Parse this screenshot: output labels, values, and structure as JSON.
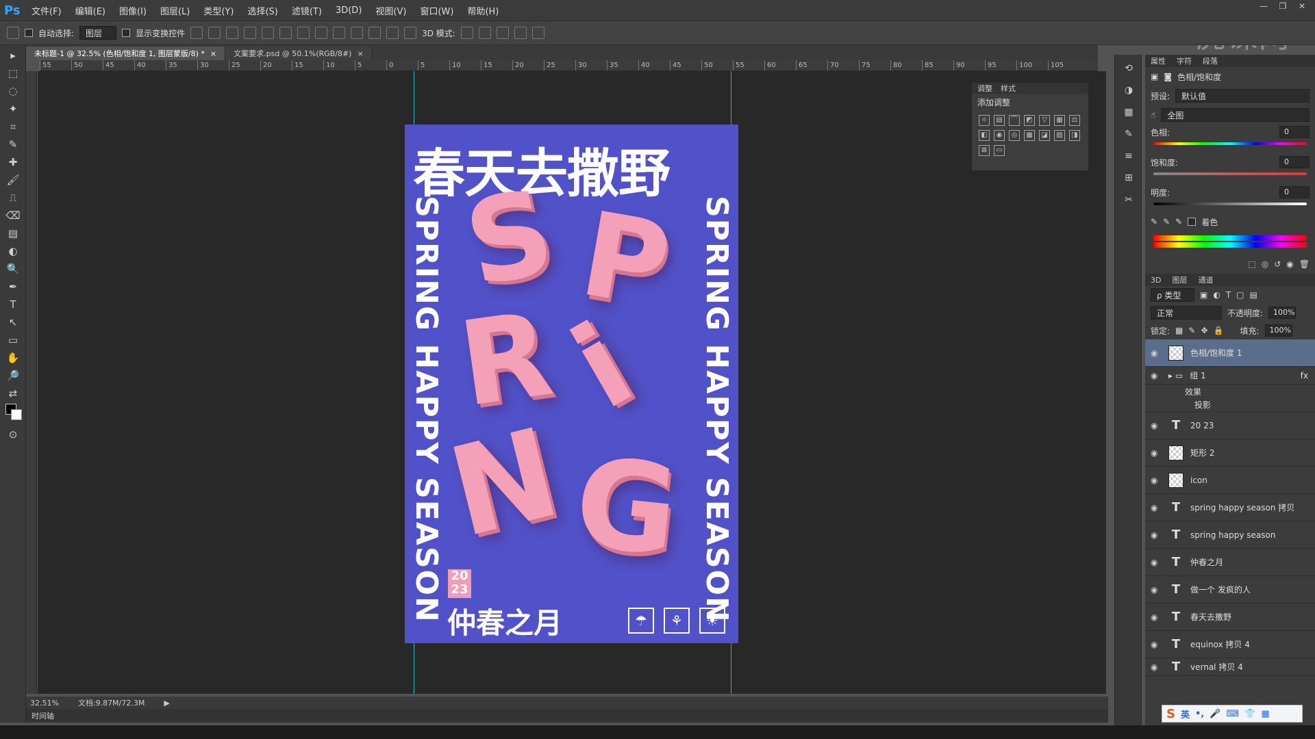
{
  "app": {
    "logo": "Ps",
    "menu": [
      "文件(F)",
      "编辑(E)",
      "图像(I)",
      "图层(L)",
      "类型(Y)",
      "选择(S)",
      "滤镜(T)",
      "3D(D)",
      "视图(V)",
      "窗口(W)",
      "帮助(H)"
    ],
    "watermark": "虎课网",
    "window_controls": [
      "—",
      "❐",
      "✕"
    ]
  },
  "options_bar": {
    "auto_select_label": "自动选择:",
    "auto_select_value": "图层",
    "show_transform_label": "显示变换控件",
    "mode_3d_label": "3D 模式:"
  },
  "tools": [
    "▸",
    "⬚",
    "◌",
    "✦",
    "⌗",
    "✎",
    "✚",
    "🖌",
    "⎍",
    "⌫",
    "▤",
    "◐",
    "🔍",
    "✒",
    "T",
    "↖",
    "▭",
    "✋",
    "🔎",
    "⇄",
    "⊙"
  ],
  "doc_tabs": [
    {
      "label": "未标题-1 @ 32.5% (色相/饱和度 1, 图层蒙版/8) *",
      "active": true
    },
    {
      "label": "文案要求.psd @ 50.1%(RGB/8#)",
      "active": false
    }
  ],
  "ruler_ticks": [
    "55",
    "50",
    "45",
    "40",
    "35",
    "30",
    "25",
    "20",
    "15",
    "10",
    "5",
    "0",
    "5",
    "10",
    "15",
    "20",
    "25",
    "30",
    "35",
    "40",
    "45",
    "50",
    "55",
    "60",
    "65",
    "70",
    "75",
    "80",
    "85",
    "90",
    "95",
    "100",
    "105"
  ],
  "poster": {
    "title": "春天去撒野",
    "bubble_letters": [
      "S",
      "P",
      "R",
      "i",
      "N",
      "G"
    ],
    "side_left": "SPRING HAPPY SEASON",
    "side_right": "SPRING HAPPY SEASON",
    "year_top": "20",
    "year_bottom": "23",
    "bottom_title": "仲春之月",
    "icons": [
      "rain-cloud-icon",
      "sprout-icon",
      "sun-cloud-icon"
    ],
    "bg_color": "#5152c9",
    "accent_color": "#f29cb6"
  },
  "adjust_panel": {
    "tabs": [
      "调整",
      "样式"
    ],
    "title": "添加调整"
  },
  "properties": {
    "tabs": [
      "属性",
      "字符",
      "段落"
    ],
    "header": "色相/饱和度",
    "preset_label": "预设:",
    "preset_value": "默认值",
    "channel_value": "全图",
    "hue_label": "色相:",
    "hue_value": "0",
    "saturation_label": "饱和度:",
    "saturation_value": "0",
    "lightness_label": "明度:",
    "lightness_value": "0",
    "colorize_label": "着色"
  },
  "layers_panel": {
    "tabs": [
      "3D",
      "图层",
      "通道"
    ],
    "kind_filter": "ρ 类型",
    "blend_mode": "正常",
    "opacity_label": "不透明度:",
    "opacity_value": "100%",
    "lock_label": "锁定:",
    "fill_label": "填充:",
    "fill_value": "100%",
    "layers": [
      {
        "name": "色相/饱和度 1",
        "kind": "adjust",
        "selected": true
      },
      {
        "name": "组 1",
        "kind": "group",
        "fx": "fx"
      },
      {
        "name": "效果",
        "kind": "effect"
      },
      {
        "name": "投影",
        "kind": "effect"
      },
      {
        "name": "20 23",
        "kind": "text"
      },
      {
        "name": "矩形 2",
        "kind": "pixel"
      },
      {
        "name": "icon",
        "kind": "pixel"
      },
      {
        "name": "spring happy season 拷贝",
        "kind": "text"
      },
      {
        "name": "spring happy season",
        "kind": "text"
      },
      {
        "name": "仲春之月",
        "kind": "text"
      },
      {
        "name": "做一个   发疯的人",
        "kind": "text"
      },
      {
        "name": "春天去撒野",
        "kind": "text"
      },
      {
        "name": "equinox 拷贝 4",
        "kind": "text"
      },
      {
        "name": "vernal 拷贝 4",
        "kind": "text"
      }
    ]
  },
  "status": {
    "zoom": "32.51%",
    "doc_size": "文档:9.87M/72.3M",
    "timeline": "时间轴"
  },
  "ime": {
    "logo": "S",
    "lang": "英"
  }
}
